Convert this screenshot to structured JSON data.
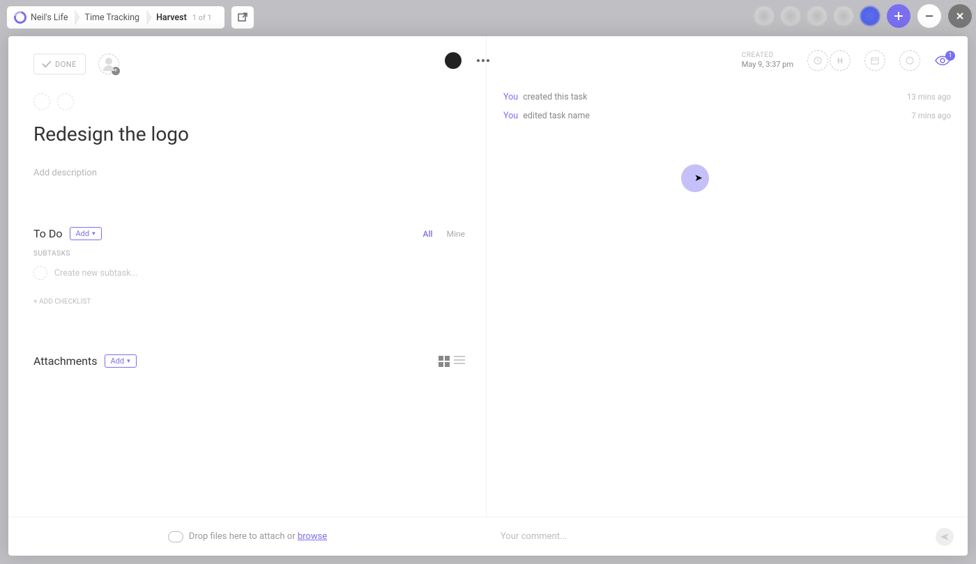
{
  "breadcrumb": {
    "space": "Neil's Life",
    "folder": "Time Tracking",
    "list": "Harvest",
    "position": "1 of 1"
  },
  "topRight": {
    "watchers": "1"
  },
  "task": {
    "doneLabel": "DONE",
    "title": "Redesign the logo",
    "descPlaceholder": "Add description"
  },
  "created": {
    "label": "CREATED",
    "datetime": "May 9, 3:37 pm"
  },
  "todo": {
    "heading": "To Do",
    "addLabel": "Add",
    "subtasksLabel": "SUBTASKS",
    "newSubtaskPlaceholder": "Create new subtask...",
    "addChecklist": "+ ADD CHECKLIST",
    "filters": {
      "all": "All",
      "mine": "Mine"
    }
  },
  "attachments": {
    "heading": "Attachments",
    "addLabel": "Add"
  },
  "activity": [
    {
      "who": "You",
      "what": "created this task",
      "when": "13 mins ago"
    },
    {
      "who": "You",
      "what": "edited task name",
      "when": "7 mins ago"
    }
  ],
  "footer": {
    "dropText": "Drop files here to attach or ",
    "browse": "browse",
    "commentPlaceholder": "Your comment..."
  }
}
